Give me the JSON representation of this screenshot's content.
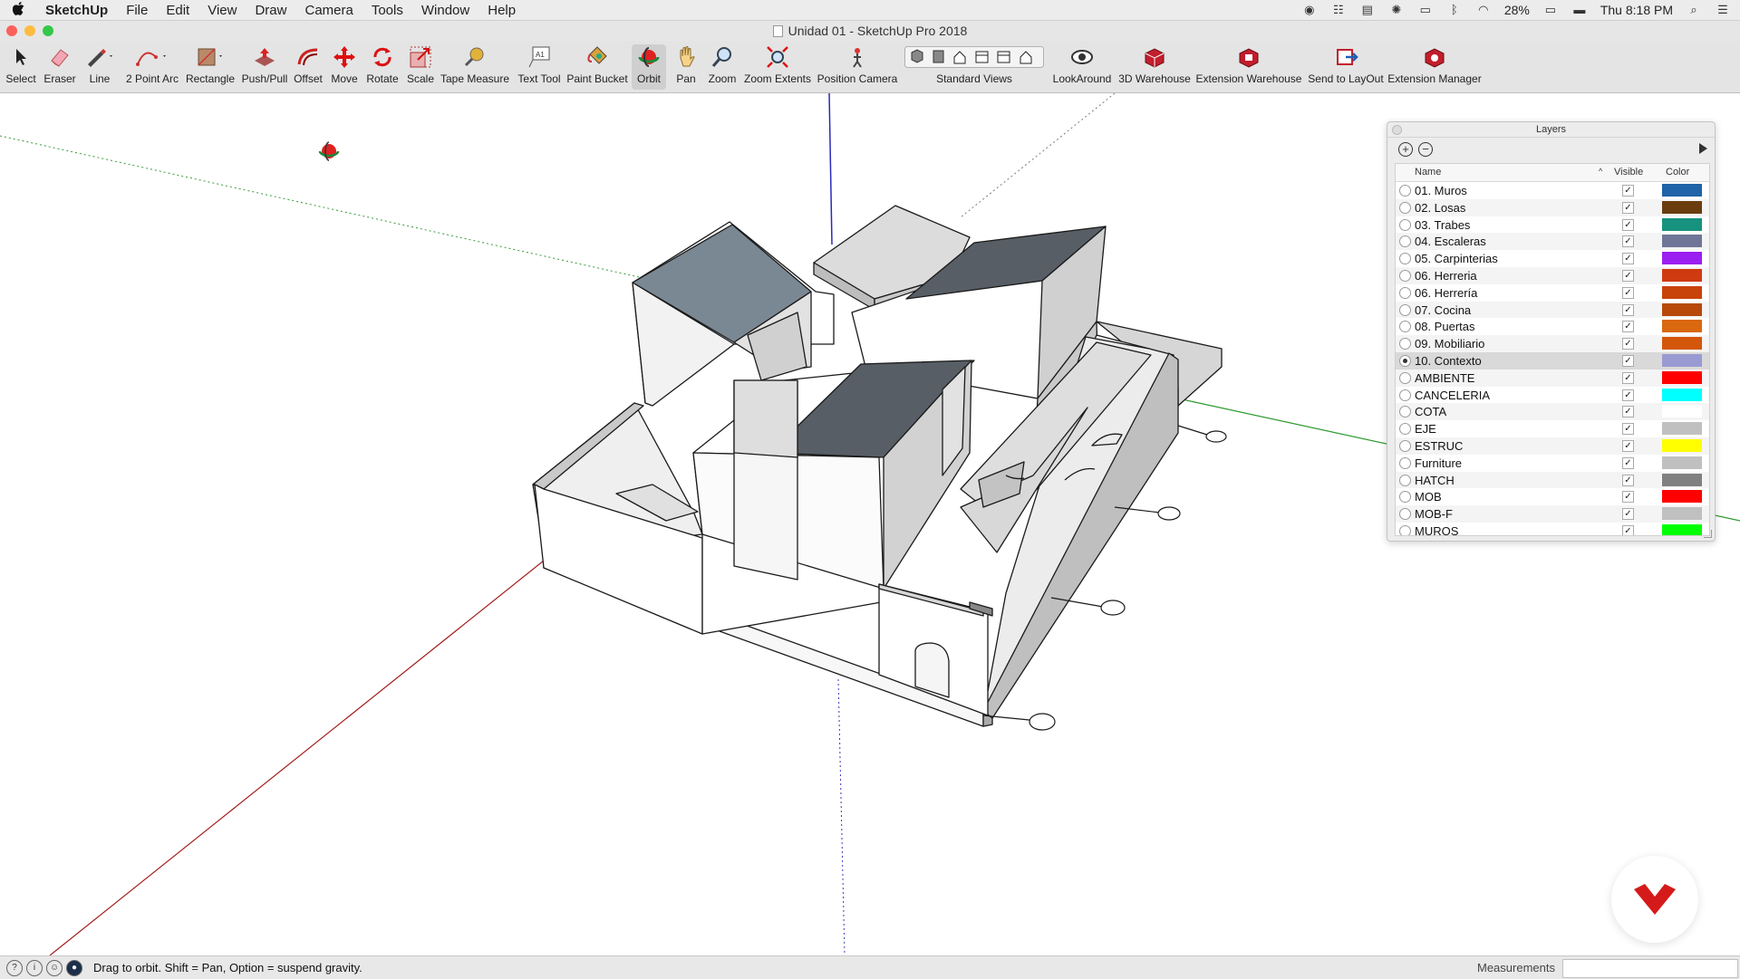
{
  "menubar": {
    "app_name": "SketchUp",
    "items": [
      "File",
      "Edit",
      "View",
      "Draw",
      "Camera",
      "Tools",
      "Window",
      "Help"
    ],
    "battery": "28%",
    "clock": "Thu 8:18 PM"
  },
  "window": {
    "title": "Unidad 01 - SketchUp Pro 2018"
  },
  "toolbar": {
    "tools": [
      {
        "label": "Select",
        "icon": "select-arrow-icon"
      },
      {
        "label": "Eraser",
        "icon": "eraser-icon"
      },
      {
        "label": "Line",
        "icon": "pencil-line-icon"
      },
      {
        "label": "2 Point Arc",
        "icon": "arc-icon"
      },
      {
        "label": "Rectangle",
        "icon": "rectangle-icon"
      },
      {
        "label": "Push/Pull",
        "icon": "push-pull-icon"
      },
      {
        "label": "Offset",
        "icon": "offset-icon"
      },
      {
        "label": "Move",
        "icon": "move-icon"
      },
      {
        "label": "Rotate",
        "icon": "rotate-icon"
      },
      {
        "label": "Scale",
        "icon": "scale-icon"
      },
      {
        "label": "Tape Measure",
        "icon": "tape-measure-icon"
      },
      {
        "label": "Text Tool",
        "icon": "text-tool-icon"
      },
      {
        "label": "Paint Bucket",
        "icon": "paint-bucket-icon"
      },
      {
        "label": "Orbit",
        "icon": "orbit-icon",
        "active": true
      },
      {
        "label": "Pan",
        "icon": "pan-hand-icon"
      },
      {
        "label": "Zoom",
        "icon": "zoom-icon"
      },
      {
        "label": "Zoom Extents",
        "icon": "zoom-extents-icon"
      },
      {
        "label": "Position Camera",
        "icon": "position-camera-icon"
      },
      {
        "label": "Standard Views",
        "icon": "standard-views-icon"
      },
      {
        "label": "LookAround",
        "icon": "look-around-icon"
      },
      {
        "label": "3D Warehouse",
        "icon": "warehouse-icon"
      },
      {
        "label": "Extension Warehouse",
        "icon": "extension-warehouse-icon"
      },
      {
        "label": "Send to LayOut",
        "icon": "send-to-layout-icon"
      },
      {
        "label": "Extension Manager",
        "icon": "extension-manager-icon"
      }
    ]
  },
  "layers_panel": {
    "title": "Layers",
    "columns": {
      "name": "Name",
      "visible": "Visible",
      "color": "Color"
    },
    "rows": [
      {
        "name": "01. Muros",
        "visible": true,
        "color": "#1f63a8",
        "active": false
      },
      {
        "name": "02. Losas",
        "visible": true,
        "color": "#6b3d0e",
        "active": false
      },
      {
        "name": "03. Trabes",
        "visible": true,
        "color": "#16927e",
        "active": false
      },
      {
        "name": "04. Escaleras",
        "visible": true,
        "color": "#6f7597",
        "active": false
      },
      {
        "name": "05. Carpinterias",
        "visible": true,
        "color": "#9b1ff0",
        "active": false
      },
      {
        "name": "06. Herreria",
        "visible": true,
        "color": "#d03a10",
        "active": false
      },
      {
        "name": "06. Herrería",
        "visible": true,
        "color": "#c8430a",
        "active": false
      },
      {
        "name": "07. Cocina",
        "visible": true,
        "color": "#b7480a",
        "active": false
      },
      {
        "name": "08. Puertas",
        "visible": true,
        "color": "#d9680e",
        "active": false
      },
      {
        "name": "09. Mobiliario",
        "visible": true,
        "color": "#d4560a",
        "active": false
      },
      {
        "name": "10. Contexto",
        "visible": true,
        "color": "#9a9ad2",
        "active": true
      },
      {
        "name": "AMBIENTE",
        "visible": true,
        "color": "#ff0000",
        "active": false
      },
      {
        "name": "CANCELERIA",
        "visible": true,
        "color": "#00ffff",
        "active": false
      },
      {
        "name": "COTA",
        "visible": true,
        "color": "#ffffff",
        "active": false
      },
      {
        "name": "EJE",
        "visible": true,
        "color": "#c0c0c0",
        "active": false
      },
      {
        "name": "ESTRUC",
        "visible": true,
        "color": "#ffff00",
        "active": false
      },
      {
        "name": "Furniture",
        "visible": true,
        "color": "#c0c0c0",
        "active": false
      },
      {
        "name": "HATCH",
        "visible": true,
        "color": "#808080",
        "active": false
      },
      {
        "name": "MOB",
        "visible": true,
        "color": "#ff0000",
        "active": false
      },
      {
        "name": "MOB-F",
        "visible": true,
        "color": "#c0c0c0",
        "active": false
      },
      {
        "name": "MUROS",
        "visible": true,
        "color": "#00ff00",
        "active": false
      }
    ]
  },
  "statusbar": {
    "hint": "Drag to orbit. Shift = Pan, Option = suspend gravity.",
    "measurements_label": "Measurements",
    "measurements_value": ""
  }
}
